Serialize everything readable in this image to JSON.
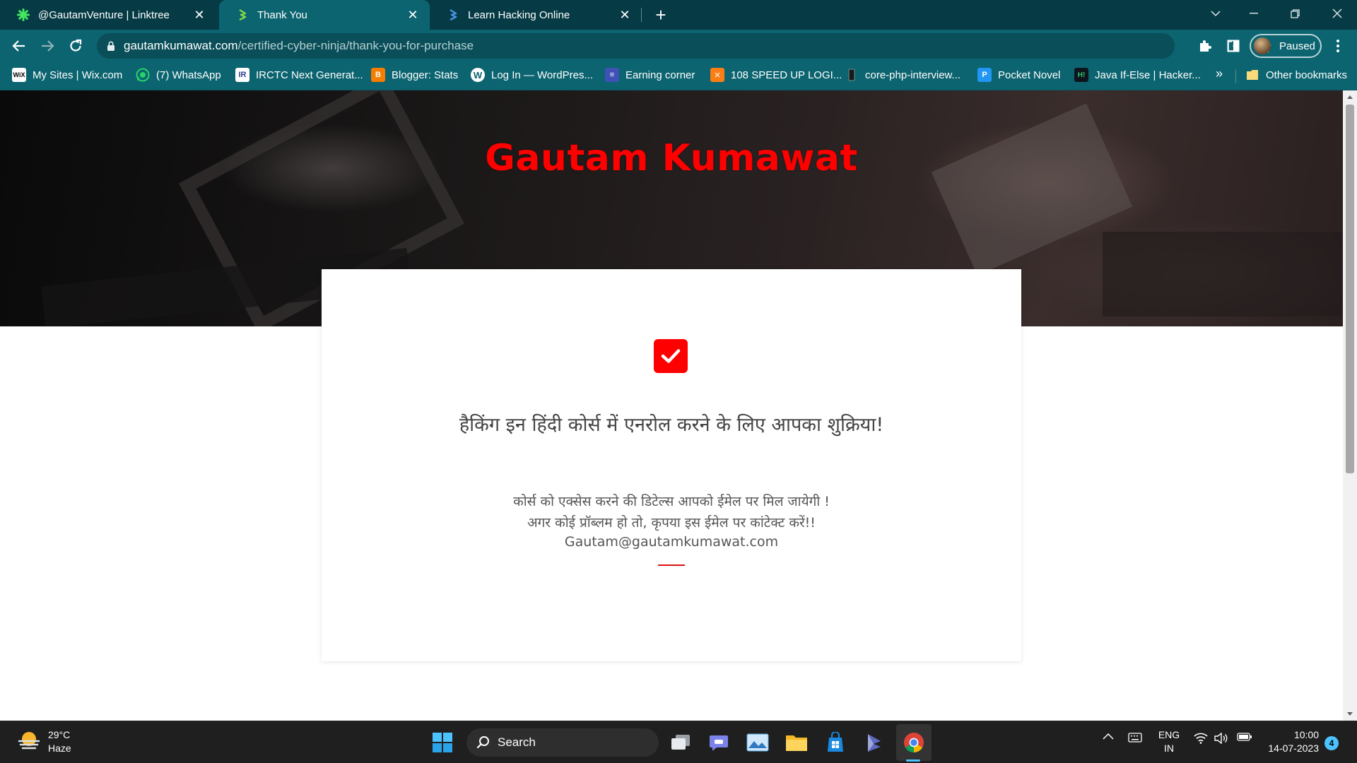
{
  "browser": {
    "tabs": [
      {
        "title": "@GautamVenture | Linktree",
        "active": false,
        "favicon": "linktree-icon"
      },
      {
        "title": "Thank You",
        "active": true,
        "favicon": "site-logo-icon"
      },
      {
        "title": "Learn Hacking Online",
        "active": false,
        "favicon": "site-logo-icon"
      }
    ],
    "address": {
      "host": "gautamkumawat.com",
      "path": "/certified-cyber-ninja/thank-you-for-purchase"
    },
    "profile_label": "Paused",
    "bookmarks": [
      {
        "label": "My Sites | Wix.com",
        "icon": "wix-icon",
        "color": "#ffffff"
      },
      {
        "label": "(7) WhatsApp",
        "icon": "whatsapp-icon",
        "color": "#25d366"
      },
      {
        "label": "IRCTC Next Generat...",
        "icon": "irctc-icon",
        "color": "#2b3f8f"
      },
      {
        "label": "Blogger: Stats",
        "icon": "blogger-icon",
        "color": "#f57d00"
      },
      {
        "label": "Log In — WordPres...",
        "icon": "wordpress-icon",
        "color": "#ffffff"
      },
      {
        "label": "Earning corner",
        "icon": "earning-icon",
        "color": "#3f51b5"
      },
      {
        "label": "108 SPEED UP LOGI...",
        "icon": "speedup-icon",
        "color": "#fb7e14"
      },
      {
        "label": "core-php-interview...",
        "icon": "phone-icon",
        "color": "#1f1f1f"
      },
      {
        "label": "Pocket Novel",
        "icon": "pocket-novel-icon",
        "color": "#2196f3"
      },
      {
        "label": "Java If-Else | Hacker...",
        "icon": "hackerrank-icon",
        "color": "#0e141e"
      }
    ],
    "bookmarks_more": "»",
    "other_bookmarks": "Other bookmarks"
  },
  "page": {
    "hero_title": "Gautam Kumawat",
    "heading": "हैकिंग इन हिंदी कोर्स में एनरोल करने के लिए आपका शुक्रिया!",
    "line1": "कोर्स को एक्सेस करने की डिटेल्स आपको ईमेल पर  मिल जायेगी !",
    "line2": "अगर कोई प्रॉब्लम हो तो, कृपया इस ईमेल पर कांटेक्ट करें!!",
    "email": "Gautam@gautamkumawat.com",
    "accent_color": "#ff0000"
  },
  "taskbar": {
    "weather_temp": "29°C",
    "weather_desc": "Haze",
    "search_label": "Search",
    "lang_line1": "ENG",
    "lang_line2": "IN",
    "time": "10:00",
    "date": "14-07-2023",
    "notifications": "4"
  }
}
